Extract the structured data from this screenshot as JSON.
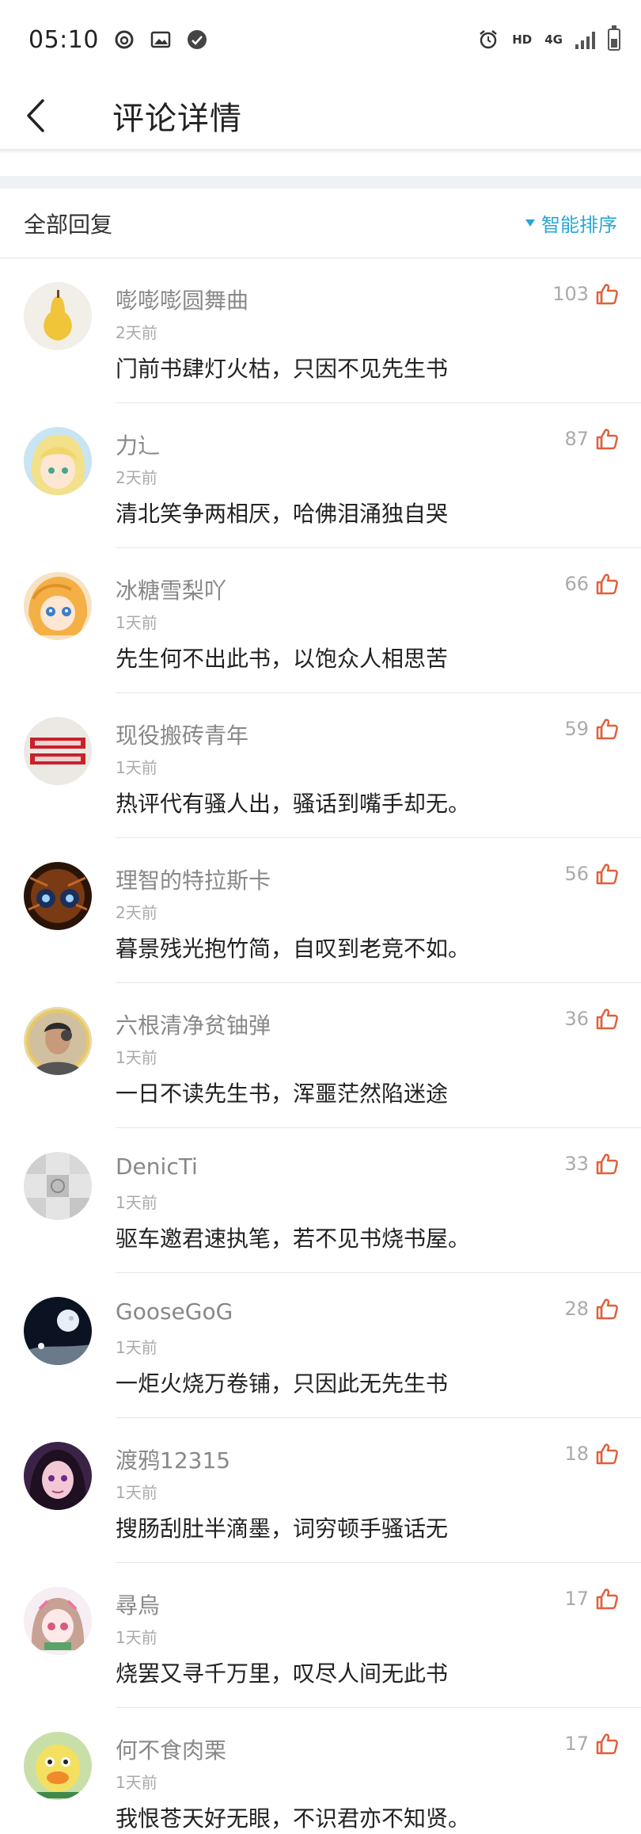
{
  "status_bar": {
    "time": "05:10",
    "icons": [
      "netease-music-icon",
      "image-icon",
      "app-badge-icon",
      "alarm-icon"
    ],
    "hd": "HD",
    "network": "4G"
  },
  "header": {
    "title": "评论详情",
    "back_icon": "chevron-left-icon"
  },
  "section": {
    "title": "全部回复",
    "sort_label": "智能排序",
    "accent_color": "#2aa7d6"
  },
  "comments": [
    {
      "username": "嘭嘭嘭圆舞曲",
      "time": "2天前",
      "text": "门前书肆灯火枯，只因不见先生书",
      "likes": "103",
      "avatar": "pear"
    },
    {
      "username": "力辶",
      "time": "2天前",
      "text": "清北笑争两相厌，哈佛泪涌独自哭",
      "likes": "87",
      "avatar": "anime-blonde"
    },
    {
      "username": "冰糖雪梨吖",
      "time": "1天前",
      "text": "先生何不出此书，以饱众人相思苦",
      "likes": "66",
      "avatar": "anime-orange"
    },
    {
      "username": "现役搬砖青年",
      "time": "1天前",
      "text": "热评代有骚人出，骚话到嘴手却无。",
      "likes": "59",
      "avatar": "text-logo"
    },
    {
      "username": "理智的特拉斯卡",
      "time": "2天前",
      "text": "暮景残光抱竹简，自叹到老竞不如。",
      "likes": "56",
      "avatar": "spider"
    },
    {
      "username": "六根清净贫铀弹",
      "time": "1天前",
      "text": "一日不读先生书，浑噩茫然陷迷途",
      "likes": "36",
      "avatar": "person"
    },
    {
      "username": "DenicTi",
      "time": "1天前",
      "text": "驱车邀君速执笔，若不见书烧书屋。",
      "likes": "33",
      "avatar": "gray-blocks"
    },
    {
      "username": "GooseGoG",
      "time": "1天前",
      "text": "一炬火烧万卷铺，只因此无先生书",
      "likes": "28",
      "avatar": "moon"
    },
    {
      "username": "渡鸦12315",
      "time": "1天前",
      "text": "搜肠刮肚半滴墨，词穷顿手骚话无",
      "likes": "18",
      "avatar": "dark-girl"
    },
    {
      "username": "尋烏",
      "time": "1天前",
      "text": "烧罢又寻千万里，叹尽人间无此书",
      "likes": "17",
      "avatar": "pink-girl"
    },
    {
      "username": "何不食肉栗",
      "time": "1天前",
      "text": "我恨苍天好无眼，不识君亦不知贤。",
      "likes": "17",
      "avatar": "duck"
    }
  ],
  "colors": {
    "like_icon": "#e0603a",
    "divider": "#e6e6e6"
  }
}
